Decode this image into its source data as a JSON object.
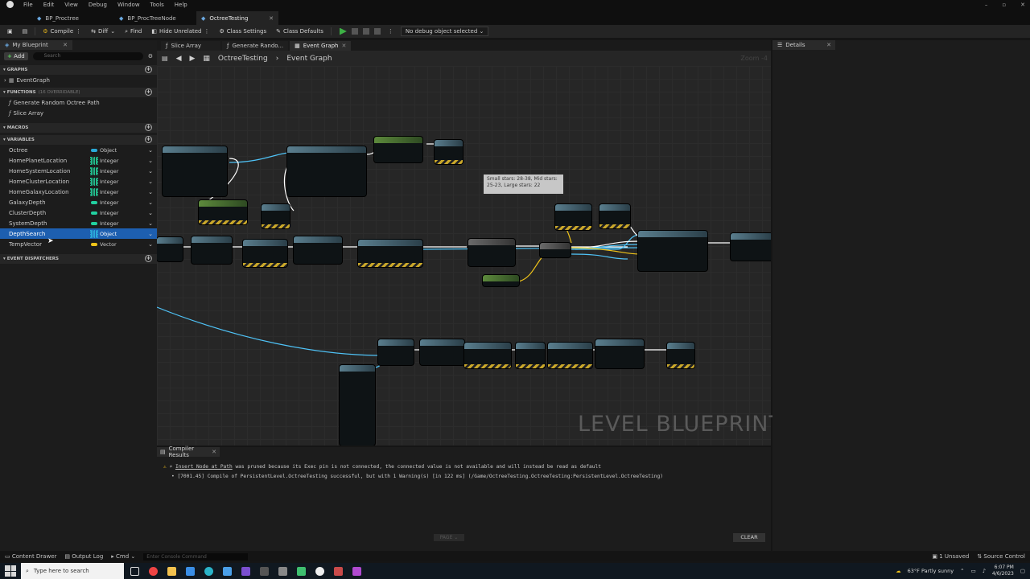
{
  "menu": [
    "File",
    "Edit",
    "View",
    "Debug",
    "Window",
    "Tools",
    "Help"
  ],
  "doc_tabs": [
    {
      "label": "BP_Proctree",
      "active": false
    },
    {
      "label": "BP_ProcTreeNode",
      "active": false
    },
    {
      "label": "OctreeTesting",
      "active": true
    }
  ],
  "toolbar": {
    "compile": "Compile",
    "diff": "Diff",
    "find": "Find",
    "hide_unrelated": "Hide Unrelated",
    "class_settings": "Class Settings",
    "class_defaults": "Class Defaults",
    "debug_object": "No debug object selected"
  },
  "my_blueprint": {
    "title": "My Blueprint",
    "add": "Add",
    "search_placeholder": "Search",
    "graphs_header": "GRAPHS",
    "graphs": [
      "EventGraph"
    ],
    "functions_header": "FUNCTIONS",
    "functions_sub": "(16 OVERRIDABLE)",
    "functions": [
      "Generate Random Octree Path",
      "Slice Array"
    ],
    "macros_header": "MACROS",
    "variables_header": "VARIABLES",
    "variables": [
      {
        "name": "Octree",
        "type": "Object",
        "color": "#2aa9d8",
        "kind": "pill"
      },
      {
        "name": "HomePlanetLocation",
        "type": "Integer",
        "color": "#22b98a",
        "kind": "grid"
      },
      {
        "name": "HomeSystemLocation",
        "type": "Integer",
        "color": "#22b98a",
        "kind": "grid"
      },
      {
        "name": "HomeClusterLocation",
        "type": "Integer",
        "color": "#22b98a",
        "kind": "grid"
      },
      {
        "name": "HomeGalaxyLocation",
        "type": "Integer",
        "color": "#22b98a",
        "kind": "grid"
      },
      {
        "name": "GalaxyDepth",
        "type": "Integer",
        "color": "#22d0a0",
        "kind": "pill"
      },
      {
        "name": "ClusterDepth",
        "type": "Integer",
        "color": "#22d0a0",
        "kind": "pill"
      },
      {
        "name": "SystemDepth",
        "type": "Integer",
        "color": "#22d0a0",
        "kind": "pill"
      },
      {
        "name": "DepthSearch",
        "type": "Object",
        "color": "#2aa9d8",
        "kind": "grid",
        "selected": true
      },
      {
        "name": "TempVector",
        "type": "Vector",
        "color": "#f0c419",
        "kind": "pill"
      }
    ],
    "dispatchers_header": "EVENT DISPATCHERS"
  },
  "graph_tabs": [
    {
      "label": "Slice Array",
      "active": false
    },
    {
      "label": "Generate Rando...",
      "active": false
    },
    {
      "label": "Event Graph",
      "active": true
    }
  ],
  "breadcrumb": {
    "root": "OctreeTesting",
    "leaf": "Event Graph"
  },
  "zoom": "Zoom -4",
  "watermark": "LEVEL BLUEPRINT",
  "comment_text": "Small stars: 28-38, Mid stars: 25-23, Large stars: 22",
  "details": {
    "title": "Details"
  },
  "compiler": {
    "title": "Compiler Results",
    "line1_node": "Insert Node at Path",
    "line1_rest": " was pruned because its Exec pin is not connected, the connected value is not available and will instead be read as default",
    "line2": "• [7001.45] Compile of PersistentLevel.OctreeTesting successful, but with 1 Warning(s) [in 122 ms] (/Game/OctreeTesting.OctreeTesting:PersistentLevel.OctreeTesting)",
    "page": "PAGE",
    "clear": "CLEAR"
  },
  "status": {
    "content_drawer": "Content Drawer",
    "output_log": "Output Log",
    "cmd": "Cmd",
    "console_placeholder": "Enter Console Command",
    "unsaved": "1 Unsaved",
    "source_control": "Source Control"
  },
  "taskbar": {
    "search_placeholder": "Type here to search",
    "weather": "63°F Partly sunny",
    "time": "6:07 PM",
    "date": "4/6/2023"
  }
}
